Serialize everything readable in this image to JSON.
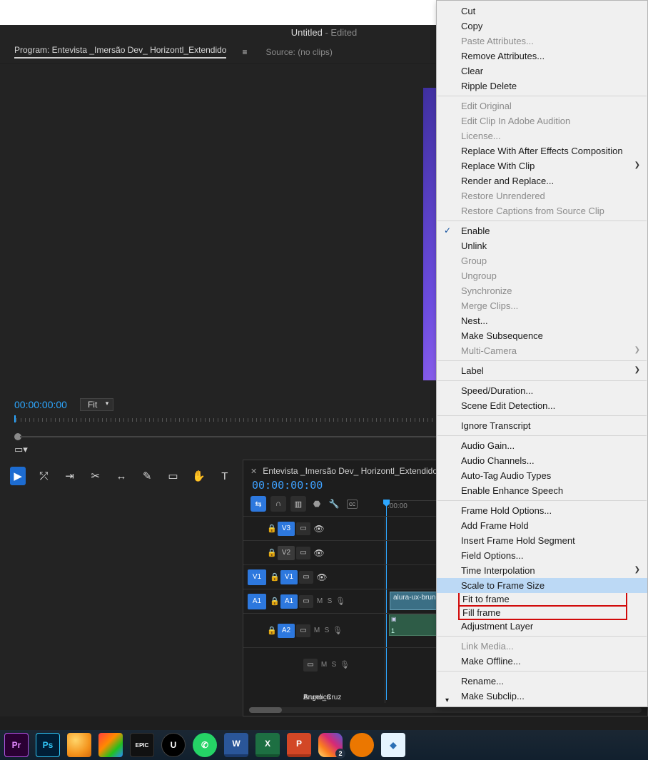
{
  "title": {
    "name": "Untitled",
    "suffix": " - Edited"
  },
  "program_tab": "Program: Entevista _Imersão Dev_ Horizontl_Extendido",
  "source_tab": "Source: (no clips)",
  "timecode": "00:00:00:00",
  "fit_label": "Fit",
  "timeline": {
    "title": "Entevista _Imersão Dev_ Horizontl_Extendido",
    "timecode": "00:00:00:00",
    "ruler_start": ":00:00",
    "tracks": {
      "v3": "V3",
      "v2": "V2",
      "v1": "V1",
      "v1src": "V1",
      "a1": "A1",
      "a1src": "A1",
      "a2": "A2",
      "m": "M",
      "s": "S"
    },
    "clip_v1": "alura-ux-brun",
    "clip_a1_num": "1",
    "clip_a2_name": "Bruno_Cruz",
    "clip_a3_name": "Angelica"
  },
  "context_menu": [
    {
      "t": "item",
      "label": "Cut"
    },
    {
      "t": "item",
      "label": "Copy"
    },
    {
      "t": "item",
      "label": "Paste Attributes...",
      "disabled": true
    },
    {
      "t": "item",
      "label": "Remove Attributes..."
    },
    {
      "t": "item",
      "label": "Clear"
    },
    {
      "t": "item",
      "label": "Ripple Delete"
    },
    {
      "t": "sep"
    },
    {
      "t": "item",
      "label": "Edit Original",
      "disabled": true
    },
    {
      "t": "item",
      "label": "Edit Clip In Adobe Audition",
      "disabled": true
    },
    {
      "t": "item",
      "label": "License...",
      "disabled": true
    },
    {
      "t": "item",
      "label": "Replace With After Effects Composition"
    },
    {
      "t": "item",
      "label": "Replace With Clip",
      "sub": true
    },
    {
      "t": "item",
      "label": "Render and Replace..."
    },
    {
      "t": "item",
      "label": "Restore Unrendered",
      "disabled": true
    },
    {
      "t": "item",
      "label": "Restore Captions from Source Clip",
      "disabled": true
    },
    {
      "t": "sep"
    },
    {
      "t": "item",
      "label": "Enable",
      "check": true
    },
    {
      "t": "item",
      "label": "Unlink"
    },
    {
      "t": "item",
      "label": "Group",
      "disabled": true
    },
    {
      "t": "item",
      "label": "Ungroup",
      "disabled": true
    },
    {
      "t": "item",
      "label": "Synchronize",
      "disabled": true
    },
    {
      "t": "item",
      "label": "Merge Clips...",
      "disabled": true
    },
    {
      "t": "item",
      "label": "Nest..."
    },
    {
      "t": "item",
      "label": "Make Subsequence"
    },
    {
      "t": "item",
      "label": "Multi-Camera",
      "disabled": true,
      "sub": true
    },
    {
      "t": "sep"
    },
    {
      "t": "item",
      "label": "Label",
      "sub": true
    },
    {
      "t": "sep"
    },
    {
      "t": "item",
      "label": "Speed/Duration..."
    },
    {
      "t": "item",
      "label": "Scene Edit Detection..."
    },
    {
      "t": "sep"
    },
    {
      "t": "item",
      "label": "Ignore Transcript"
    },
    {
      "t": "sep"
    },
    {
      "t": "item",
      "label": "Audio Gain..."
    },
    {
      "t": "item",
      "label": "Audio Channels..."
    },
    {
      "t": "item",
      "label": "Auto-Tag Audio Types"
    },
    {
      "t": "item",
      "label": "Enable Enhance Speech"
    },
    {
      "t": "sep"
    },
    {
      "t": "item",
      "label": "Frame Hold Options..."
    },
    {
      "t": "item",
      "label": "Add Frame Hold"
    },
    {
      "t": "item",
      "label": "Insert Frame Hold Segment"
    },
    {
      "t": "item",
      "label": "Field Options..."
    },
    {
      "t": "item",
      "label": "Time Interpolation",
      "sub": true
    },
    {
      "t": "item",
      "label": "Scale to Frame Size",
      "hover": true
    },
    {
      "t": "box",
      "label": "Fit to frame"
    },
    {
      "t": "box",
      "label": "Fill frame"
    },
    {
      "t": "item",
      "label": "Adjustment Layer"
    },
    {
      "t": "sep"
    },
    {
      "t": "item",
      "label": "Link Media...",
      "disabled": true
    },
    {
      "t": "item",
      "label": "Make Offline..."
    },
    {
      "t": "sep"
    },
    {
      "t": "item",
      "label": "Rename..."
    },
    {
      "t": "item",
      "label": "Make Subclip..."
    }
  ],
  "taskbar_badge": "2"
}
